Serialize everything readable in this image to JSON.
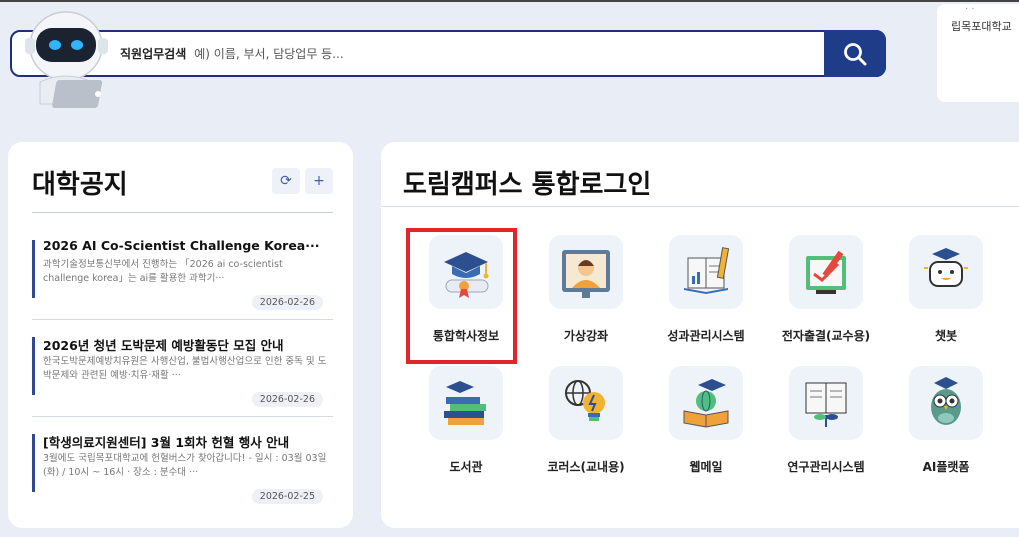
{
  "search": {
    "label": "직원업무검색",
    "placeholder": "예) 이름, 부서, 담당업무 등..."
  },
  "right_card": {
    "line1": "· ·",
    "line2": "립목포대학교"
  },
  "notices": {
    "title": "대학공지",
    "items": [
      {
        "title": "2026 AI Co-Scientist Challenge Korea···",
        "desc": "과학기술정보통신부에서 진행하는 「2026 ai co-scientist challenge korea」는 ai를 활용한 과학기···",
        "date": "2026-02-26"
      },
      {
        "title": "2026년 청년 도박문제 예방활동단 모집 안내",
        "desc": "한국도박문제예방치유원은 사행산업, 불법사행산업으로 인한 중독 및 도박문제와 관련된 예방·치유·재활 ···",
        "date": "2026-02-26"
      },
      {
        "title": "[학생의료지원센터] 3월 1회차 헌혈 행사 안내",
        "desc": "3월에도 국립목포대학교에 헌혈버스가 찾아갑니다! - 일시 : 03월 03일 (화) / 10시 ~ 16시 · 장소 : 분수대 ···",
        "date": "2026-02-25"
      }
    ]
  },
  "login": {
    "title": "도림캠퍼스 통합로그인",
    "tiles": [
      {
        "label": "통합학사정보",
        "icon": "graduation-cap-diploma-icon"
      },
      {
        "label": "가상강좌",
        "icon": "virtual-lecture-icon"
      },
      {
        "label": "성과관리시스템",
        "icon": "performance-book-icon"
      },
      {
        "label": "전자출결(교수용)",
        "icon": "attendance-check-icon"
      },
      {
        "label": "챗봇",
        "icon": "chatbot-icon"
      },
      {
        "label": "도서관",
        "icon": "library-books-icon"
      },
      {
        "label": "코러스(교내용)",
        "icon": "lightbulb-globe-icon"
      },
      {
        "label": "웹메일",
        "icon": "webmail-globe-book-icon"
      },
      {
        "label": "연구관리시스템",
        "icon": "research-book-plant-icon"
      },
      {
        "label": "AI플랫폼",
        "icon": "ai-owl-icon"
      }
    ]
  },
  "colors": {
    "navy": "#1e3c88",
    "highlight": "#e3242b",
    "background": "#e9eef6"
  }
}
